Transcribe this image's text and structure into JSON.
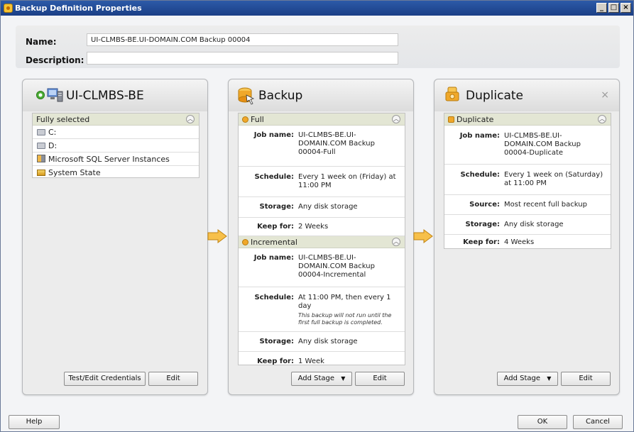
{
  "window": {
    "title": "Backup Definition Properties"
  },
  "form": {
    "name_label": "Name:",
    "name_value": "UI-CLMBS-BE.UI-DOMAIN.COM Backup 00004",
    "description_label": "Description:",
    "description_value": ""
  },
  "source_panel": {
    "title": "UI-CLMBS-BE",
    "section": "Fully selected",
    "items": [
      {
        "label": "C:",
        "icon": "drive-icon"
      },
      {
        "label": "D:",
        "icon": "drive-icon"
      },
      {
        "label": "Microsoft SQL Server Instances",
        "icon": "sql-server-icon"
      },
      {
        "label": "System State",
        "icon": "system-state-icon"
      }
    ],
    "btn_credentials": "Test/Edit Credentials",
    "btn_edit": "Edit"
  },
  "backup_panel": {
    "title": "Backup",
    "full": {
      "header": "Full",
      "job_name_label": "Job name:",
      "job_name": "UI-CLMBS-BE.UI-DOMAIN.COM Backup 00004-Full",
      "schedule_label": "Schedule:",
      "schedule": "Every 1 week on (Friday) at 11:00 PM",
      "storage_label": "Storage:",
      "storage": "Any disk storage",
      "keep_label": "Keep for:",
      "keep": "2 Weeks"
    },
    "incremental": {
      "header": "Incremental",
      "job_name_label": "Job name:",
      "job_name": "UI-CLMBS-BE.UI-DOMAIN.COM Backup 00004-Incremental",
      "schedule_label": "Schedule:",
      "schedule": "At 11:00 PM, then every 1 day",
      "schedule_note": "This backup will not run until the first full backup is completed.",
      "storage_label": "Storage:",
      "storage": "Any disk storage",
      "keep_label": "Keep for:",
      "keep": "1 Week"
    },
    "btn_add_stage": "Add Stage",
    "btn_edit": "Edit"
  },
  "duplicate_panel": {
    "title": "Duplicate",
    "section": "Duplicate",
    "job_name_label": "Job name:",
    "job_name": "UI-CLMBS-BE.UI-DOMAIN.COM Backup 00004-Duplicate",
    "schedule_label": "Schedule:",
    "schedule": "Every 1 week on (Saturday) at 11:00 PM",
    "source_label": "Source:",
    "source": "Most recent full backup",
    "storage_label": "Storage:",
    "storage": "Any disk storage",
    "keep_label": "Keep for:",
    "keep": "4 Weeks",
    "btn_add_stage": "Add Stage",
    "btn_edit": "Edit",
    "close_glyph": "×"
  },
  "footer": {
    "help": "Help",
    "ok": "OK",
    "cancel": "Cancel"
  },
  "colors": {
    "titlebar": "#1b3f86",
    "section_head": "#e3e6d4",
    "arrow": "#f5b335"
  }
}
